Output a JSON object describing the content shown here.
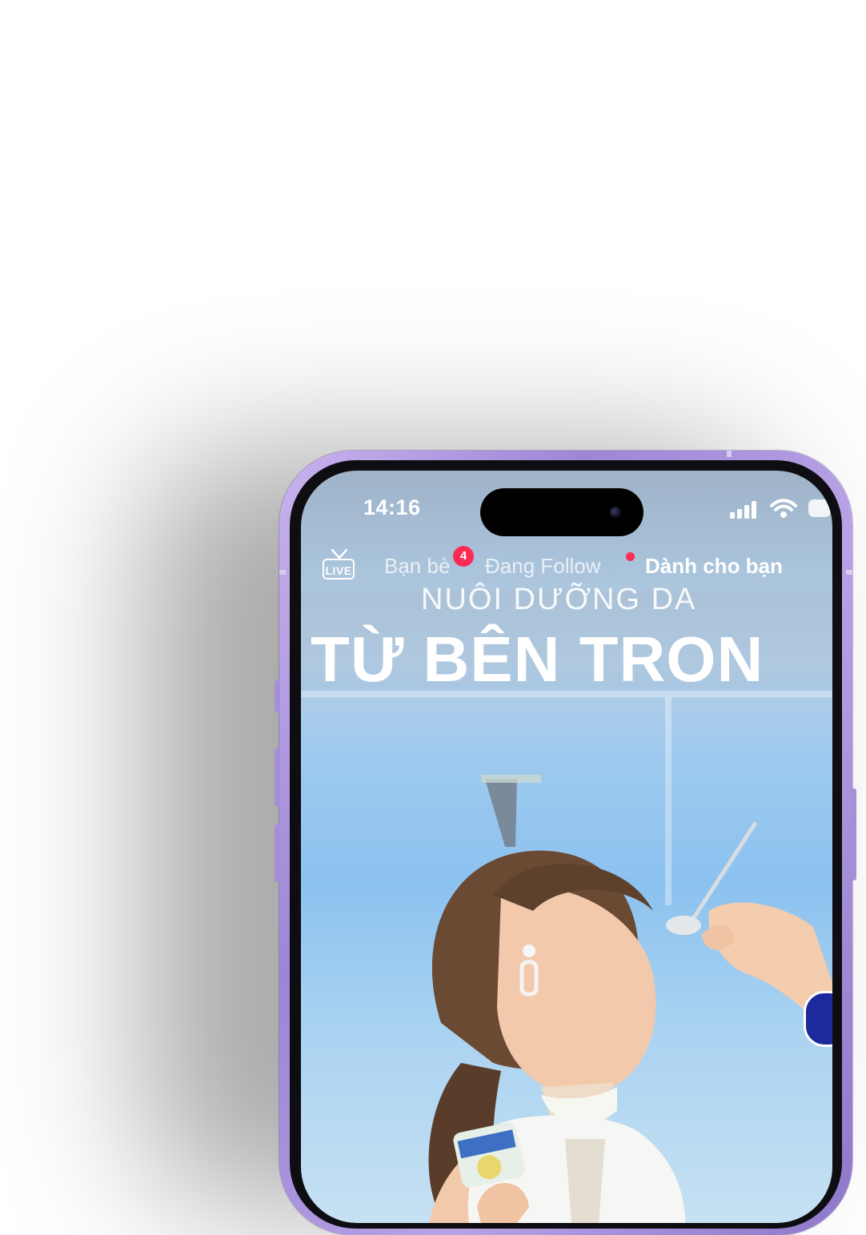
{
  "status_bar": {
    "time": "14:16"
  },
  "top_nav": {
    "live_label": "LIVE",
    "tabs": [
      {
        "label": "Bạn bè",
        "badge": "4"
      },
      {
        "label": "Đang Follow"
      },
      {
        "label": "Dành cho bạn"
      }
    ]
  },
  "video": {
    "headline_line1": "NUÔI DƯỠNG DA",
    "headline_line2": "TỪ BÊN TRON"
  },
  "colors": {
    "phone_frame": "#a58fd9",
    "badge": "#fe2c55"
  }
}
